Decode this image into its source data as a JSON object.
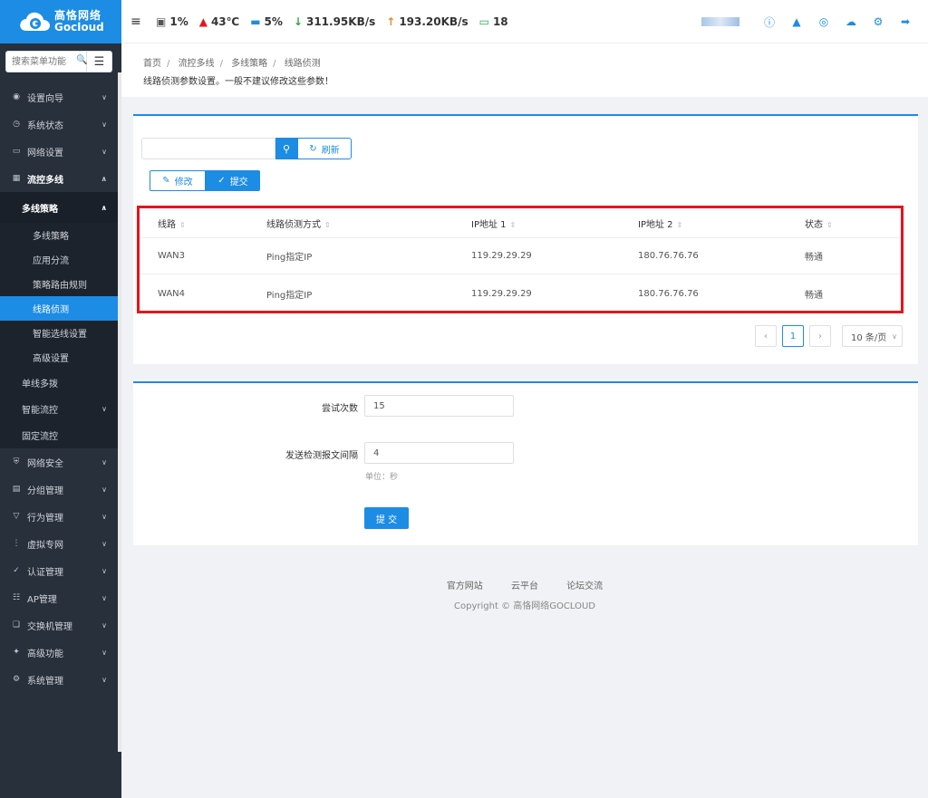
{
  "brand": {
    "name_cn": "高恪网络",
    "name_en": "Gocloud"
  },
  "sidebar": {
    "search_placeholder": "搜索菜单功能",
    "menu_top": [
      {
        "label": "设置向导",
        "icon": "compass-icon"
      },
      {
        "label": "系统状态",
        "icon": "gauge-icon"
      },
      {
        "label": "网络设置",
        "icon": "monitor-icon"
      }
    ],
    "open_menu": {
      "label": "流控多线",
      "icon": "sitemap-icon"
    },
    "open_sub": {
      "label": "多线策略"
    },
    "sub_items": [
      "多线策略",
      "应用分流",
      "策略路由规则",
      "线路侦测",
      "智能选线设置",
      "高级设置"
    ],
    "plain_items": [
      {
        "label": "单线多拨",
        "has_chev": false
      },
      {
        "label": "智能流控",
        "has_chev": true
      },
      {
        "label": "固定流控",
        "has_chev": false
      }
    ],
    "menu_bottom": [
      {
        "label": "网络安全",
        "icon": "shield-icon"
      },
      {
        "label": "分组管理",
        "icon": "list-icon"
      },
      {
        "label": "行为管理",
        "icon": "filter-icon"
      },
      {
        "label": "虚拟专网",
        "icon": "vpn-icon"
      },
      {
        "label": "认证管理",
        "icon": "check-shield-icon"
      },
      {
        "label": "AP管理",
        "icon": "network-icon"
      },
      {
        "label": "交换机管理",
        "icon": "switch-icon"
      },
      {
        "label": "高级功能",
        "icon": "pin-icon"
      },
      {
        "label": "系统管理",
        "icon": "gear-icon"
      }
    ]
  },
  "header": {
    "cpu": "1%",
    "temp": "43℃",
    "mem": "5%",
    "down": "311.95KB/s",
    "up": "193.20KB/s",
    "devices": "18"
  },
  "breadcrumb": {
    "items": [
      "首页",
      "流控多线",
      "多线策略",
      "线路侦测"
    ],
    "desc": "线路侦测参数设置。一般不建议修改这些参数！"
  },
  "toolbar": {
    "refresh": "刷新",
    "edit": "修改",
    "submit": "提交"
  },
  "table": {
    "headers": [
      "线路",
      "线路侦测方式",
      "IP地址 1",
      "IP地址 2",
      "状态"
    ],
    "rows": [
      [
        "WAN3",
        "Ping指定IP",
        "119.29.29.29",
        "180.76.76.76",
        "畅通"
      ],
      [
        "WAN4",
        "Ping指定IP",
        "119.29.29.29",
        "180.76.76.76",
        "畅通"
      ]
    ]
  },
  "pagination": {
    "current": "1",
    "page_size": "10 条/页"
  },
  "form": {
    "retries_label": "尝试次数",
    "retries_value": "15",
    "interval_label": "发送检测报文间隔",
    "interval_value": "4",
    "interval_hint": "单位：秒",
    "submit": "提 交"
  },
  "footer": {
    "links": [
      "官方网站",
      "云平台",
      "论坛交流"
    ],
    "copyright": "Copyright © 高恪网络GOCLOUD"
  },
  "colors": {
    "accent": "#1c8ce5",
    "sidebar_bg": "#28303c",
    "highlight_border": "#e5141e"
  }
}
